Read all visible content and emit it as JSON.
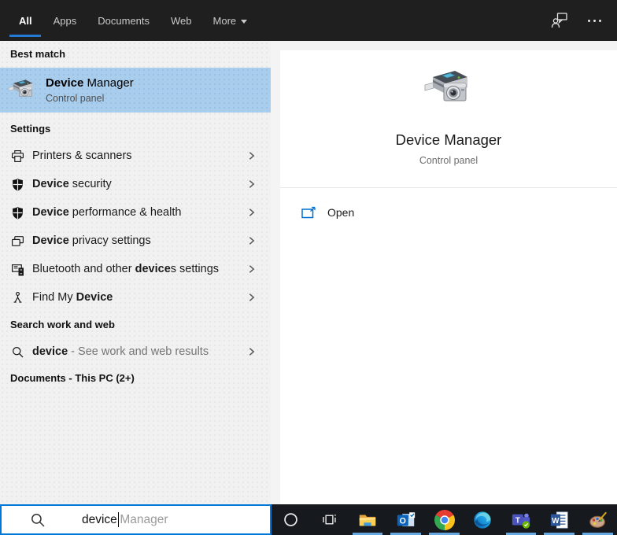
{
  "topbar": {
    "tabs": [
      {
        "label": "All",
        "active": true
      },
      {
        "label": "Apps",
        "active": false
      },
      {
        "label": "Documents",
        "active": false
      },
      {
        "label": "Web",
        "active": false
      },
      {
        "label": "More",
        "active": false,
        "has_caret": true
      }
    ],
    "icons": {
      "feedback": "feedback-icon",
      "more_options": "more-options-icon"
    }
  },
  "left": {
    "best_match": {
      "header": "Best match",
      "item": {
        "icon": "device-manager-icon",
        "title_bold": "Device",
        "title_rest": " Manager",
        "subtitle": "Control panel"
      }
    },
    "settings": {
      "header": "Settings",
      "items": [
        {
          "icon": "printer-icon",
          "pre": "Printers & scanners",
          "bold": "",
          "post": ""
        },
        {
          "icon": "shield-icon",
          "pre": "",
          "bold": "Device",
          "post": " security"
        },
        {
          "icon": "shield-icon",
          "pre": "",
          "bold": "Device",
          "post": " performance & health"
        },
        {
          "icon": "devices-icon",
          "pre": "",
          "bold": "Device",
          "post": " privacy settings"
        },
        {
          "icon": "bluetooth-devices-icon",
          "pre": "Bluetooth and other ",
          "bold": "device",
          "post": "s settings"
        },
        {
          "icon": "find-my-device-icon",
          "pre": "Find My ",
          "bold": "Device",
          "post": ""
        }
      ]
    },
    "web_search": {
      "header": "Search work and web",
      "item": {
        "icon": "search-icon",
        "bold": "device",
        "rest": " - See work and web results"
      }
    },
    "documents": {
      "header": "Documents - This PC (2+)"
    }
  },
  "preview": {
    "icon": "device-manager-icon",
    "title": "Device Manager",
    "subtitle": "Control panel",
    "actions": [
      {
        "icon": "open-icon",
        "label": "Open"
      }
    ]
  },
  "search_box": {
    "icon": "search-icon",
    "typed": "device",
    "suggestion": "Manager"
  },
  "taskbar": {
    "items": [
      {
        "icon": "cortana-icon",
        "running": false
      },
      {
        "icon": "task-view-icon",
        "running": false
      },
      {
        "icon": "file-explorer-icon",
        "running": true
      },
      {
        "icon": "outlook-icon",
        "running": true
      },
      {
        "icon": "chrome-icon",
        "running": true
      },
      {
        "icon": "edge-icon",
        "running": false
      },
      {
        "icon": "teams-icon",
        "running": true
      },
      {
        "icon": "word-icon",
        "running": true
      },
      {
        "icon": "paint-icon",
        "running": true
      }
    ]
  },
  "colors": {
    "accent": "#0078d7",
    "tab_underline": "#2479d2",
    "selection": "#a9cded",
    "taskbar_indicator": "#68a8e0",
    "topbar_bg": "#1f1f1f",
    "taskbar_bg": "#16191e"
  }
}
